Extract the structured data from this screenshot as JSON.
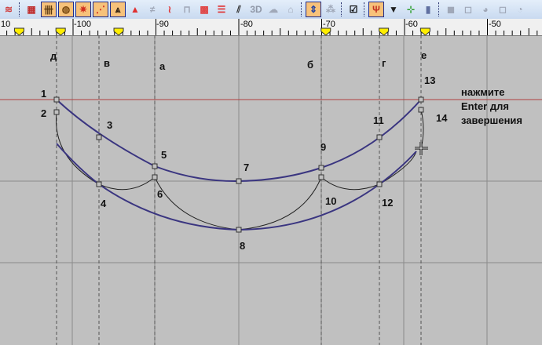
{
  "toolbar": {
    "buttons": [
      {
        "icon": "arch-icon",
        "glyph": "≋",
        "color": "#d04040"
      },
      {
        "sep": true
      },
      {
        "icon": "grid-frame-icon",
        "glyph": "▦",
        "color": "#c03030"
      },
      {
        "icon": "hatch-vertical-icon",
        "glyph": "卌",
        "color": "#5a3a10",
        "on": true
      },
      {
        "icon": "hatch-circle-icon",
        "glyph": "◍",
        "color": "#7a4a10",
        "on": true
      },
      {
        "icon": "burst-icon",
        "glyph": "✷",
        "color": "#d03020",
        "on": true
      },
      {
        "icon": "fan-lines-icon",
        "glyph": "⋰",
        "color": "#d03020",
        "on": true
      },
      {
        "icon": "triangle-hatch-icon",
        "glyph": "⩓",
        "color": "#302010",
        "on": true
      },
      {
        "icon": "triangle-red-icon",
        "glyph": "▲",
        "color": "#e03030"
      },
      {
        "icon": "zigzag-grey-icon",
        "glyph": "≠",
        "color": "#a0a8b8"
      },
      {
        "icon": "wave-red-icon",
        "glyph": "≀",
        "color": "#e03030"
      },
      {
        "icon": "square-wave-icon",
        "glyph": "⊓",
        "color": "#a0a8b8"
      },
      {
        "icon": "dots-pattern-icon",
        "glyph": "▩",
        "color": "#e04040"
      },
      {
        "icon": "horizontal-lines-icon",
        "glyph": "☰",
        "color": "#e03030"
      },
      {
        "icon": "diagonal-dashes-icon",
        "glyph": "⫽",
        "color": "#303030"
      },
      {
        "icon": "3d-icon",
        "glyph": "3D",
        "color": "#9098a8"
      },
      {
        "icon": "cloud-icon",
        "glyph": "☁",
        "color": "#a0a8b8"
      },
      {
        "icon": "tv-icon",
        "glyph": "⌂",
        "color": "#a0a8b8"
      },
      {
        "sep": true
      },
      {
        "icon": "insert-point-icon",
        "glyph": "⇕",
        "color": "#2040a0",
        "on": true
      },
      {
        "icon": "node-grey-icon",
        "glyph": "⁂",
        "color": "#a0a8b8"
      },
      {
        "sep": true
      },
      {
        "icon": "checkbox-icon",
        "glyph": "☑",
        "color": "#000"
      },
      {
        "sep": true
      },
      {
        "icon": "fork-icon",
        "glyph": "Ψ",
        "color": "#c03020",
        "on": true
      },
      {
        "icon": "triangle-down-icon",
        "glyph": "▼",
        "color": "#202020"
      },
      {
        "icon": "node-tree-icon",
        "glyph": "⊹",
        "color": "#30a030"
      },
      {
        "icon": "panel-icon",
        "glyph": "▮",
        "color": "#6070a0"
      },
      {
        "sep": true
      },
      {
        "icon": "shape-union-icon",
        "glyph": "◼",
        "color": "#a0a8b8"
      },
      {
        "icon": "shape-subtract-icon",
        "glyph": "◻",
        "color": "#a0a8b8"
      },
      {
        "icon": "shape-intersect-icon",
        "glyph": "◕",
        "color": "#a0a8b8"
      },
      {
        "icon": "shape-exclude-icon",
        "glyph": "◻",
        "color": "#a0a8b8"
      },
      {
        "icon": "shape-split-icon",
        "glyph": "◔",
        "color": "#a0a8b8"
      }
    ]
  },
  "ruler": {
    "labels": [
      "10",
      "-100",
      "-90",
      "-80",
      "-70",
      "-60",
      "-50"
    ],
    "marker_values": [
      -106.5,
      -101.5,
      -94.5,
      -69.5,
      -62.5,
      -57.5
    ]
  },
  "axis_letters": [
    "д",
    "в",
    "а",
    "б",
    "г",
    "е"
  ],
  "point_labels": [
    "1",
    "2",
    "3",
    "4",
    "5",
    "6",
    "7",
    "8",
    "9",
    "10",
    "11",
    "12",
    "13",
    "14"
  ],
  "hint": {
    "line1": "нажмите",
    "line2": "Enter для",
    "line3": "завершения"
  },
  "colors": {
    "curve": "#3a3580",
    "grid": "#8a8a8a",
    "red_line": "#d02020"
  }
}
